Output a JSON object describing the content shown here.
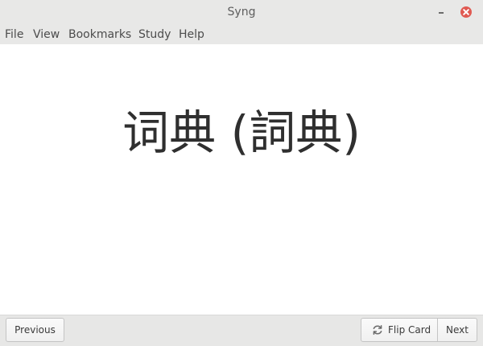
{
  "window": {
    "title": "Syng"
  },
  "menubar": {
    "items": [
      {
        "label": "File"
      },
      {
        "label": "View"
      },
      {
        "label": "Bookmarks"
      },
      {
        "label": "Study"
      },
      {
        "label": "Help"
      }
    ]
  },
  "card": {
    "text": "词典 (詞典)"
  },
  "toolbar": {
    "previous_label": "Previous",
    "flip_label": "Flip Card",
    "next_label": "Next"
  },
  "icons": {
    "close": "close-icon",
    "minimize": "minimize-icon",
    "flip": "refresh-icon"
  },
  "colors": {
    "close_button": "#e05a52",
    "titlebar": "#e8e8e7",
    "text": "#2f2f2f"
  }
}
